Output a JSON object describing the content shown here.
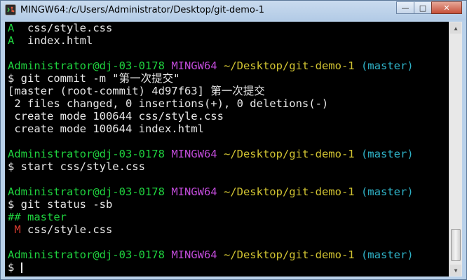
{
  "window": {
    "title": "MINGW64:/c/Users/Administrator/Desktop/git-demo-1",
    "minimize": "—",
    "maximize": "□",
    "close": "✕",
    "icon": "git-bash-icon"
  },
  "terminal": {
    "staged_1": {
      "status": "A",
      "file": "css/style.css"
    },
    "staged_2": {
      "status": "A",
      "file": "index.html"
    },
    "prompt_1": {
      "user": "Administrator@dj-03-0178",
      "shell": "MINGW64",
      "path": "~/Desktop/git-demo-1",
      "branch": "(master)"
    },
    "cmd_commit": "$ git commit -m \"第一次提交\"",
    "out_commit_1": "[master (root-commit) 4d97f63] 第一次提交",
    "out_commit_2": " 2 files changed, 0 insertions(+), 0 deletions(-)",
    "out_commit_3": " create mode 100644 css/style.css",
    "out_commit_4": " create mode 100644 index.html",
    "prompt_2": {
      "user": "Administrator@dj-03-0178",
      "shell": "MINGW64",
      "path": "~/Desktop/git-demo-1",
      "branch": "(master)"
    },
    "cmd_start": "$ start css/style.css",
    "prompt_3": {
      "user": "Administrator@dj-03-0178",
      "shell": "MINGW64",
      "path": "~/Desktop/git-demo-1",
      "branch": "(master)"
    },
    "cmd_status": "$ git status -sb",
    "out_status_branch": "## master",
    "out_status_file": {
      "status": "M",
      "file": "css/style.css"
    },
    "prompt_4": {
      "user": "Administrator@dj-03-0178",
      "shell": "MINGW64",
      "path": "~/Desktop/git-demo-1",
      "branch": "(master)"
    },
    "cmd_current": "$ "
  },
  "colors": {
    "user": "#1fd43f",
    "shell": "#c04bd8",
    "path": "#d2c432",
    "branch": "#2fb3c8",
    "modified": "#d83a2f"
  }
}
